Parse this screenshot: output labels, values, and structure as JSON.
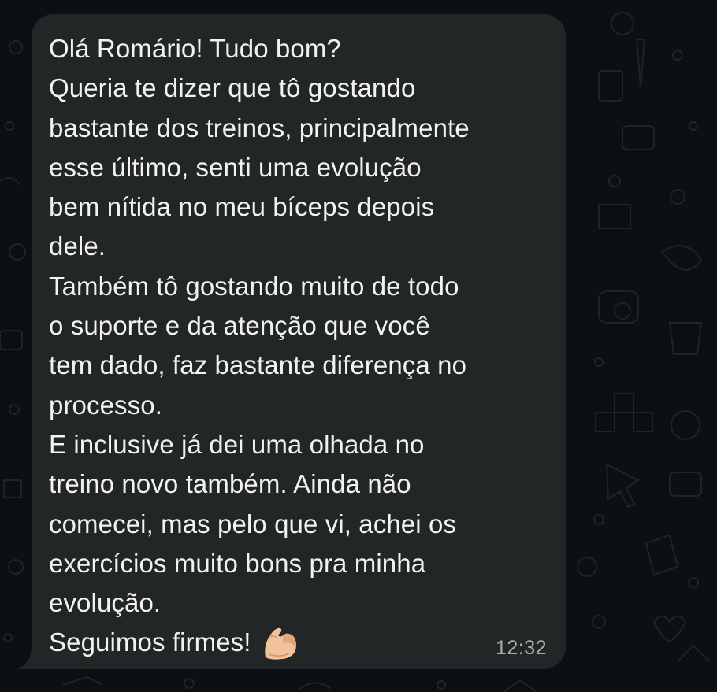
{
  "chat": {
    "message": {
      "lines": [
        "Olá Romário! Tudo bom?",
        "Queria te dizer que tô gostando",
        "bastante dos treinos, principalmente",
        "esse último, senti uma evolução",
        "bem nítida no meu bíceps depois",
        "dele.",
        "Também tô gostando muito de todo",
        "o suporte e da atenção que você",
        "tem dado, faz bastante diferença no",
        "processo.",
        "E inclusive já dei uma olhada no",
        "treino novo também. Ainda não",
        "comecei, mas pelo que vi, achei os",
        "exercícios muito bons pra minha",
        "evolução.",
        "Seguimos firmes!"
      ],
      "emoji": "flexed-biceps-icon",
      "time": "12:32"
    }
  },
  "colors": {
    "background": "#0b1014",
    "bubble": "#232626",
    "text": "#f2f2f2",
    "timestamp": "#a9adb0",
    "doodle": "#1e2a2e"
  }
}
